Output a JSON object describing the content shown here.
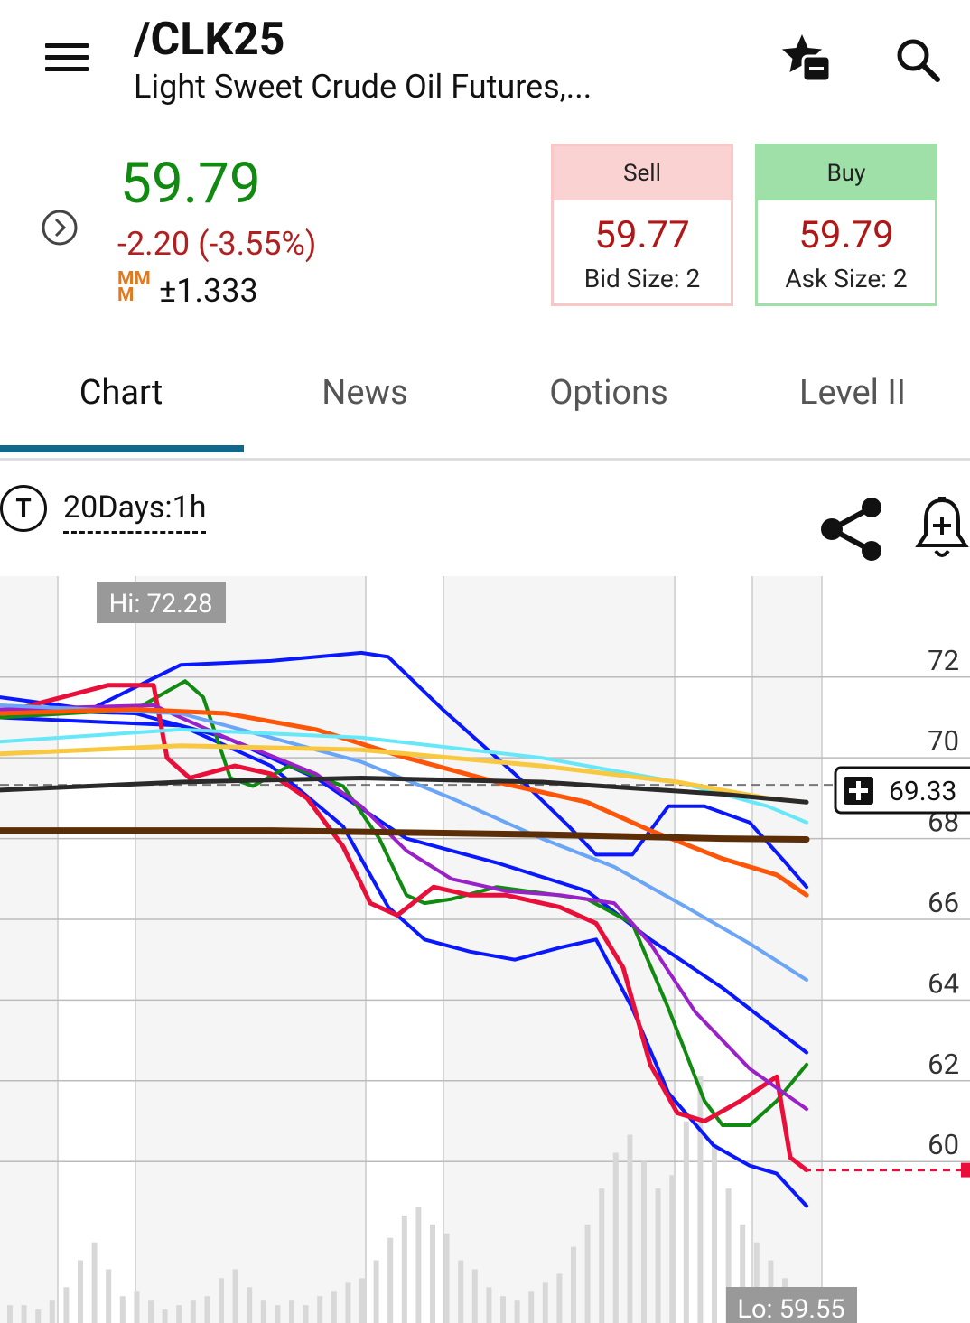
{
  "header": {
    "symbol": "/CLK25",
    "description": "Light Sweet Crude Oil Futures,..."
  },
  "quote": {
    "last": "59.79",
    "change": "-2.20 (-3.55%)",
    "mm_label": "MM M",
    "mm_value": "±1.333",
    "sell": {
      "label": "Sell",
      "price": "59.77",
      "size": "Bid Size: 2"
    },
    "buy": {
      "label": "Buy",
      "price": "59.79",
      "size": "Ask Size: 2"
    }
  },
  "tabs": [
    {
      "label": "Chart",
      "active": true
    },
    {
      "label": "News"
    },
    {
      "label": "Options"
    },
    {
      "label": "Level II"
    }
  ],
  "toolbar": {
    "period": "20Days:1h",
    "type_icon_label": "T"
  },
  "colors": {
    "price_green": "#118a11",
    "change_red": "#b02020",
    "sell_header": "#fad2d2",
    "buy_header": "#9fe0a8",
    "tab_underline": "#11688d"
  },
  "chart_data": {
    "type": "line",
    "hi_label": "Hi: 72.28",
    "lo_label": "Lo: 59.55",
    "marker_label": "69.33",
    "yticks": [
      "72",
      "70",
      "68",
      "66",
      "64",
      "62",
      "60"
    ],
    "ylim": [
      56,
      74.5
    ],
    "last_price": 59.79,
    "series": [
      {
        "color": "#0a18ff",
        "width": 4,
        "points": [
          [
            0,
            71.5
          ],
          [
            100,
            71.2
          ],
          [
            200,
            72.3
          ],
          [
            300,
            72.4
          ],
          [
            400,
            72.6
          ],
          [
            430,
            72.5
          ],
          [
            490,
            71.2
          ],
          [
            570,
            69.6
          ],
          [
            630,
            68.3
          ],
          [
            660,
            67.6
          ],
          [
            700,
            67.6
          ],
          [
            740,
            68.8
          ],
          [
            780,
            68.8
          ],
          [
            830,
            68.4
          ],
          [
            870,
            67.4
          ],
          [
            893,
            66.8
          ]
        ]
      },
      {
        "color": "#0a18ff",
        "width": 4,
        "points": [
          [
            0,
            71.0
          ],
          [
            200,
            70.8
          ],
          [
            300,
            69.8
          ],
          [
            380,
            68.3
          ],
          [
            430,
            66.3
          ],
          [
            470,
            65.5
          ],
          [
            520,
            65.2
          ],
          [
            570,
            65.0
          ],
          [
            620,
            65.3
          ],
          [
            660,
            65.5
          ],
          [
            700,
            63.8
          ],
          [
            740,
            61.7
          ],
          [
            790,
            60.4
          ],
          [
            830,
            59.9
          ],
          [
            860,
            59.7
          ],
          [
            893,
            58.9
          ]
        ]
      },
      {
        "color": "#0a18ff",
        "width": 4,
        "points": [
          [
            0,
            71.2
          ],
          [
            150,
            71.1
          ],
          [
            250,
            70.5
          ],
          [
            350,
            69.5
          ],
          [
            450,
            68.0
          ],
          [
            550,
            67.4
          ],
          [
            650,
            66.7
          ],
          [
            720,
            65.5
          ],
          [
            800,
            64.3
          ],
          [
            893,
            62.7
          ]
        ]
      },
      {
        "color": "#118a11",
        "width": 4,
        "points": [
          [
            0,
            71.0
          ],
          [
            150,
            71.2
          ],
          [
            205,
            71.9
          ],
          [
            225,
            71.5
          ],
          [
            255,
            69.5
          ],
          [
            280,
            69.3
          ],
          [
            320,
            69.8
          ],
          [
            380,
            69.3
          ],
          [
            420,
            68.0
          ],
          [
            450,
            66.6
          ],
          [
            470,
            66.4
          ],
          [
            500,
            66.5
          ],
          [
            550,
            66.8
          ],
          [
            650,
            66.5
          ],
          [
            700,
            65.9
          ],
          [
            740,
            63.8
          ],
          [
            780,
            61.5
          ],
          [
            800,
            60.9
          ],
          [
            830,
            60.9
          ],
          [
            860,
            61.5
          ],
          [
            893,
            62.4
          ]
        ]
      },
      {
        "color": "#e8103a",
        "width": 5,
        "points": [
          [
            0,
            71.1
          ],
          [
            120,
            71.8
          ],
          [
            170,
            71.8
          ],
          [
            185,
            70.0
          ],
          [
            210,
            69.5
          ],
          [
            260,
            69.8
          ],
          [
            300,
            69.6
          ],
          [
            340,
            69.0
          ],
          [
            380,
            67.8
          ],
          [
            410,
            66.4
          ],
          [
            440,
            66.1
          ],
          [
            480,
            66.8
          ],
          [
            520,
            66.6
          ],
          [
            560,
            66.6
          ],
          [
            620,
            66.3
          ],
          [
            660,
            65.9
          ],
          [
            690,
            64.8
          ],
          [
            720,
            62.4
          ],
          [
            750,
            61.2
          ],
          [
            780,
            61.0
          ],
          [
            820,
            61.5
          ],
          [
            860,
            62.1
          ],
          [
            875,
            60.1
          ],
          [
            893,
            59.79
          ]
        ]
      },
      {
        "color": "#9a20c8",
        "width": 4,
        "points": [
          [
            0,
            71.2
          ],
          [
            170,
            71.3
          ],
          [
            250,
            70.5
          ],
          [
            350,
            69.6
          ],
          [
            400,
            68.8
          ],
          [
            450,
            67.7
          ],
          [
            500,
            67.0
          ],
          [
            560,
            66.7
          ],
          [
            620,
            66.6
          ],
          [
            680,
            66.4
          ],
          [
            720,
            65.4
          ],
          [
            770,
            63.7
          ],
          [
            830,
            62.3
          ],
          [
            893,
            61.3
          ]
        ]
      },
      {
        "color": "#6aa5f8",
        "width": 4,
        "points": [
          [
            0,
            71.3
          ],
          [
            200,
            71.1
          ],
          [
            300,
            70.5
          ],
          [
            400,
            69.9
          ],
          [
            500,
            69.0
          ],
          [
            600,
            68.0
          ],
          [
            680,
            67.3
          ],
          [
            760,
            66.3
          ],
          [
            830,
            65.4
          ],
          [
            893,
            64.5
          ]
        ]
      },
      {
        "color": "#ff5508",
        "width": 5,
        "points": [
          [
            0,
            71.1
          ],
          [
            150,
            71.2
          ],
          [
            250,
            71.1
          ],
          [
            350,
            70.7
          ],
          [
            450,
            70.0
          ],
          [
            550,
            69.4
          ],
          [
            650,
            68.9
          ],
          [
            720,
            68.2
          ],
          [
            800,
            67.5
          ],
          [
            860,
            67.1
          ],
          [
            893,
            66.6
          ]
        ]
      },
      {
        "color": "#66e8f8",
        "width": 4,
        "points": [
          [
            0,
            70.4
          ],
          [
            200,
            70.7
          ],
          [
            400,
            70.5
          ],
          [
            600,
            70.0
          ],
          [
            750,
            69.4
          ],
          [
            850,
            68.8
          ],
          [
            893,
            68.4
          ]
        ]
      },
      {
        "color": "#f8c840",
        "width": 5,
        "points": [
          [
            0,
            70.1
          ],
          [
            200,
            70.3
          ],
          [
            400,
            70.2
          ],
          [
            600,
            69.8
          ],
          [
            750,
            69.4
          ],
          [
            850,
            69.0
          ],
          [
            893,
            68.9
          ]
        ]
      },
      {
        "color": "#2a2a2a",
        "width": 5,
        "points": [
          [
            0,
            69.2
          ],
          [
            200,
            69.4
          ],
          [
            400,
            69.5
          ],
          [
            600,
            69.4
          ],
          [
            800,
            69.1
          ],
          [
            893,
            68.9
          ]
        ]
      },
      {
        "color": "#5c2e08",
        "width": 7,
        "points": [
          [
            0,
            68.2
          ],
          [
            300,
            68.2
          ],
          [
            600,
            68.1
          ],
          [
            800,
            68.0
          ],
          [
            893,
            67.98
          ]
        ]
      }
    ]
  }
}
